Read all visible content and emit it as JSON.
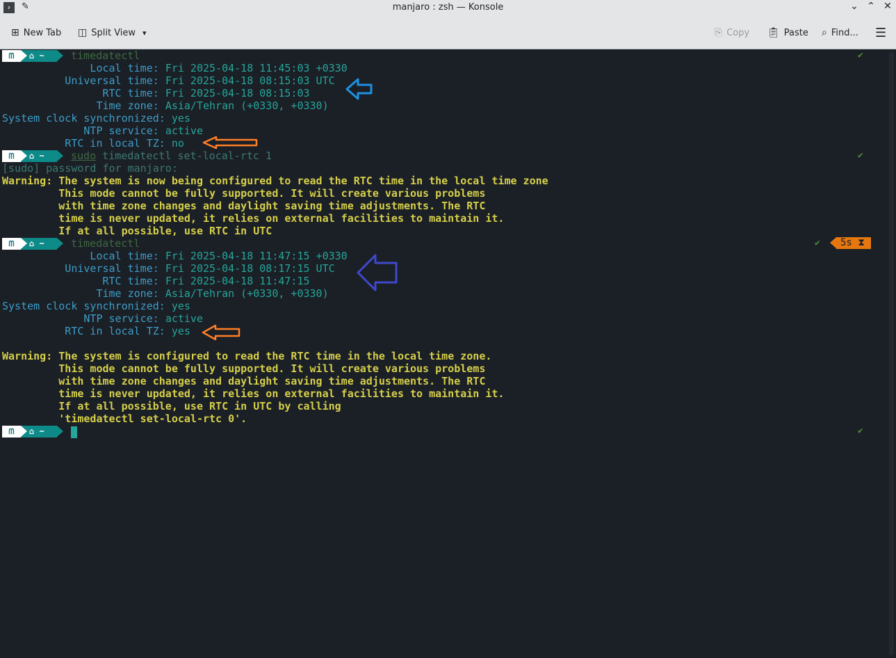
{
  "window": {
    "title": "manjaro : zsh — Konsole",
    "app_icon": "terminal-icon",
    "pin_icon": "pin-icon",
    "controls": [
      "chevron-down-icon",
      "chevron-up-icon",
      "close-icon"
    ]
  },
  "toolbar": {
    "new_tab": "New Tab",
    "split_view": "Split View",
    "copy": "Copy",
    "paste": "Paste",
    "find": "Find..."
  },
  "prompt": {
    "os_glyph": "ᗰ",
    "home_glyph": "⌂",
    "dir": "~",
    "check": "✔"
  },
  "terminal": {
    "block1": {
      "cmd": "timedatectl",
      "lines": [
        {
          "key": "              Local time: ",
          "val": "Fri 2025-04-18 11:45:03 +0330"
        },
        {
          "key": "          Universal time: ",
          "val": "Fri 2025-04-18 08:15:03 UTC"
        },
        {
          "key": "                RTC time: ",
          "val": "Fri 2025-04-18 08:15:03"
        },
        {
          "key": "               Time zone: ",
          "val": "Asia/Tehran (+0330, +0330)"
        },
        {
          "key": "System clock synchronized: ",
          "val": "yes"
        },
        {
          "key": "             NTP service: ",
          "val": "active"
        },
        {
          "key": "          RTC in local TZ: ",
          "val": "no"
        }
      ]
    },
    "block2": {
      "sudo": "sudo",
      "cmd": "timedatectl set-local-rtc 1",
      "password": "[sudo] password for manjaro:",
      "warn_label": "Warning:",
      "warn_lines": [
        " The system is now being configured to read the RTC time in the local time zone",
        "         This mode cannot be fully supported. It will create various problems",
        "         with time zone changes and daylight saving time adjustments. The RTC",
        "         time is never updated, it relies on external facilities to maintain it.",
        "         If at all possible, use RTC in UTC"
      ]
    },
    "block3": {
      "cmd": "timedatectl",
      "duration": "5s",
      "hourglass": "⧗",
      "lines": [
        {
          "key": "              Local time: ",
          "val": "Fri 2025-04-18 11:47:15 +0330"
        },
        {
          "key": "          Universal time: ",
          "val": "Fri 2025-04-18 08:17:15 UTC"
        },
        {
          "key": "                RTC time: ",
          "val": "Fri 2025-04-18 11:47:15"
        },
        {
          "key": "               Time zone: ",
          "val": "Asia/Tehran (+0330, +0330)"
        },
        {
          "key": "System clock synchronized: ",
          "val": "yes"
        },
        {
          "key": "             NTP service: ",
          "val": "active"
        },
        {
          "key": "          RTC in local TZ: ",
          "val": "yes"
        }
      ],
      "warn_label": "Warning:",
      "warn_lines": [
        " The system is configured to read the RTC time in the local time zone.",
        "         This mode cannot be fully supported. It will create various problems",
        "         with time zone changes and daylight saving time adjustments. The RTC",
        "         time is never updated, it relies on external facilities to maintain it.",
        "         If at all possible, use RTC in UTC by calling",
        "         'timedatectl set-local-rtc 0'."
      ]
    }
  },
  "colors": {
    "background": "#1b1f26",
    "teal": "#26a69a",
    "key_blue": "#3d9ec9",
    "warning_yellow": "#d6d04a",
    "orange_arrow": "#ff7f27",
    "blue_arrow_1": "#1e90e0",
    "blue_arrow_2": "#3f48cc"
  }
}
